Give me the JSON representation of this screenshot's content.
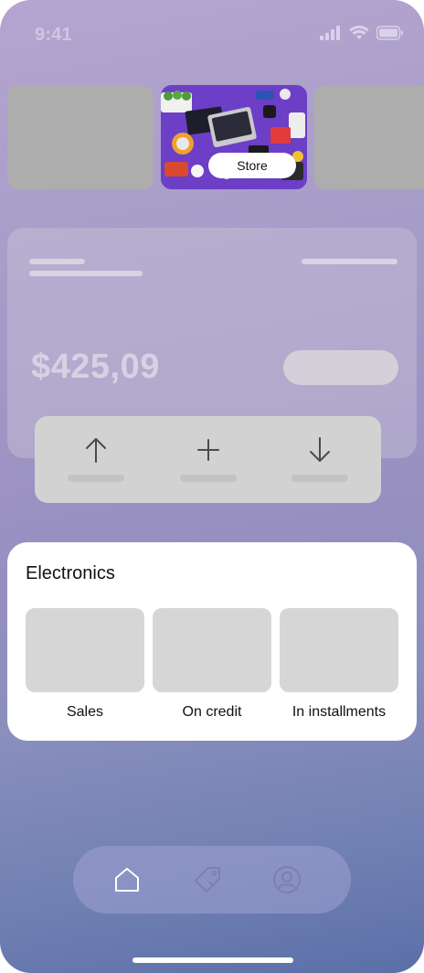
{
  "status_bar": {
    "time": "9:41",
    "icons": [
      "signal-icon",
      "wifi-icon",
      "battery-icon"
    ]
  },
  "carousel": {
    "center_label": "Store"
  },
  "balance": {
    "amount": "$425,09"
  },
  "actions": [
    "arrow-up-icon",
    "plus-icon",
    "arrow-down-icon"
  ],
  "electronics": {
    "title": "Electronics",
    "items": [
      {
        "label": "Sales"
      },
      {
        "label": "On credit"
      },
      {
        "label": "In installments"
      }
    ]
  },
  "nav": {
    "items": [
      "home-icon",
      "tag-icon",
      "profile-icon"
    ],
    "active": "home-icon"
  },
  "colors": {
    "card": "#ffffff",
    "tile": "#d6d6d6",
    "nav_active": "#ffffff"
  }
}
